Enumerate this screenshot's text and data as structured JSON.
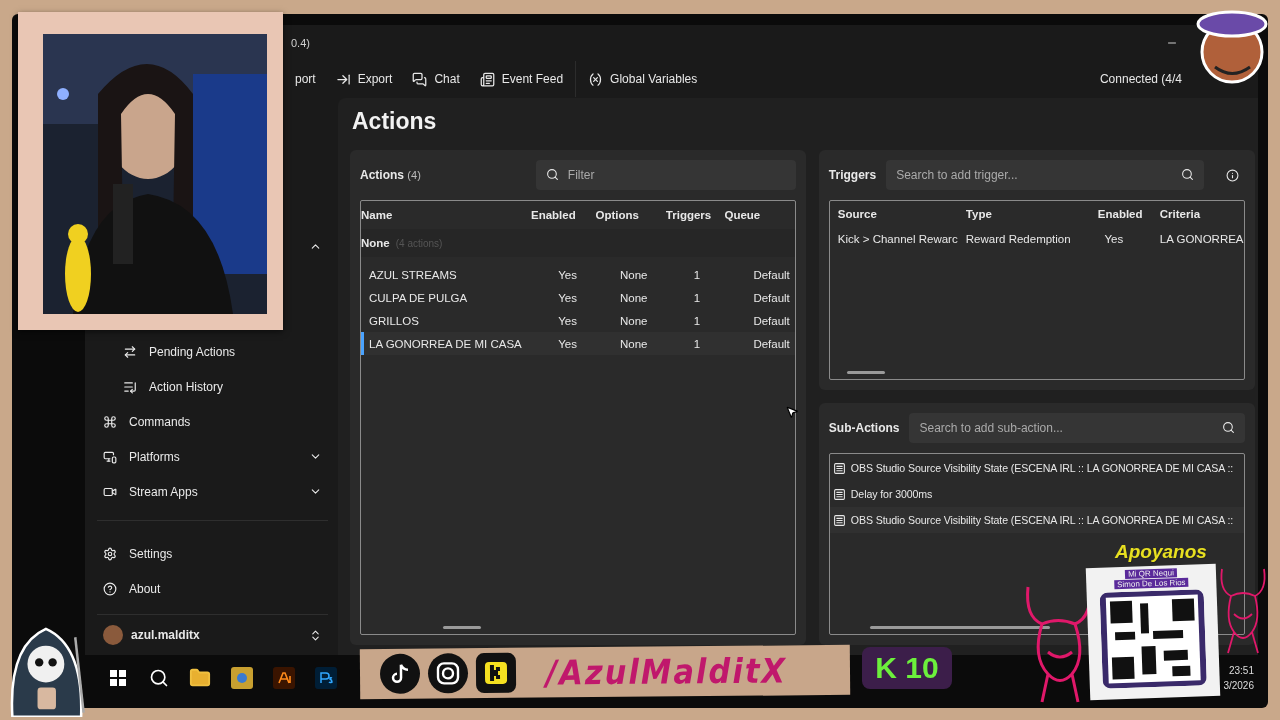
{
  "window": {
    "title": "0.4)"
  },
  "toolbar": {
    "items": [
      {
        "label": "port"
      },
      {
        "label": "Export"
      },
      {
        "label": "Chat"
      },
      {
        "label": "Event Feed"
      },
      {
        "label": "Global Variables"
      }
    ],
    "status": "Connected (4/4"
  },
  "sidebar": {
    "items": [
      {
        "kind": "group",
        "expanded": true,
        "children": [
          {
            "label": "Pending Actions",
            "selected": false
          },
          {
            "label": "Action History",
            "selected": false
          }
        ]
      },
      {
        "kind": "link",
        "label": "Commands"
      },
      {
        "kind": "group",
        "label": "Platforms",
        "expanded": false
      },
      {
        "kind": "group",
        "label": "Stream Apps",
        "expanded": false
      }
    ],
    "footer": [
      {
        "label": "Settings"
      },
      {
        "label": "About"
      }
    ],
    "user": "azul.malditx"
  },
  "page": {
    "title": "Actions"
  },
  "actions": {
    "title": "Actions",
    "count": "(4)",
    "filter": {
      "placeholder": "Filter"
    },
    "columns": [
      "Name",
      "Enabled",
      "Options",
      "Triggers",
      "Queue"
    ],
    "group": {
      "name": "None",
      "count": "(4 actions)"
    },
    "rows": [
      {
        "name": "AZUL STREAMS",
        "enabled": "Yes",
        "options": "None",
        "triggers": "1",
        "queue": "Default",
        "selected": false
      },
      {
        "name": "CULPA DE PULGA",
        "enabled": "Yes",
        "options": "None",
        "triggers": "1",
        "queue": "Default",
        "selected": false
      },
      {
        "name": "GRILLOS",
        "enabled": "Yes",
        "options": "None",
        "triggers": "1",
        "queue": "Default",
        "selected": false
      },
      {
        "name": "LA GONORREA DE MI CASA",
        "enabled": "Yes",
        "options": "None",
        "triggers": "1",
        "queue": "Default",
        "selected": true
      }
    ]
  },
  "triggers": {
    "title": "Triggers",
    "search": {
      "placeholder": "Search to add trigger..."
    },
    "columns": [
      "Source",
      "Type",
      "Enabled",
      "Criteria"
    ],
    "rows": [
      {
        "source": "Kick > Channel Rewarc",
        "type": "Reward Redemption",
        "enabled": "Yes",
        "criteria": "LA GONORREA"
      }
    ]
  },
  "sub_actions": {
    "title": "Sub-Actions",
    "search": {
      "placeholder": "Search to add sub-action..."
    },
    "items": [
      "OBS Studio Source Visibility State (ESCENA IRL :: LA GONORREA DE MI CASA ::",
      "Delay for 3000ms",
      "OBS Studio Source Visibility State (ESCENA IRL :: LA GONORREA DE MI CASA ::"
    ]
  },
  "taskbar": {
    "time": "23:51",
    "date": "3/2026"
  },
  "overlay": {
    "handle": "/AzulMalditX",
    "badge": "K 10",
    "support": {
      "title": "Apoyanos",
      "lines": [
        "Mi QR Nequi",
        "Simon De Los Rios"
      ]
    }
  }
}
